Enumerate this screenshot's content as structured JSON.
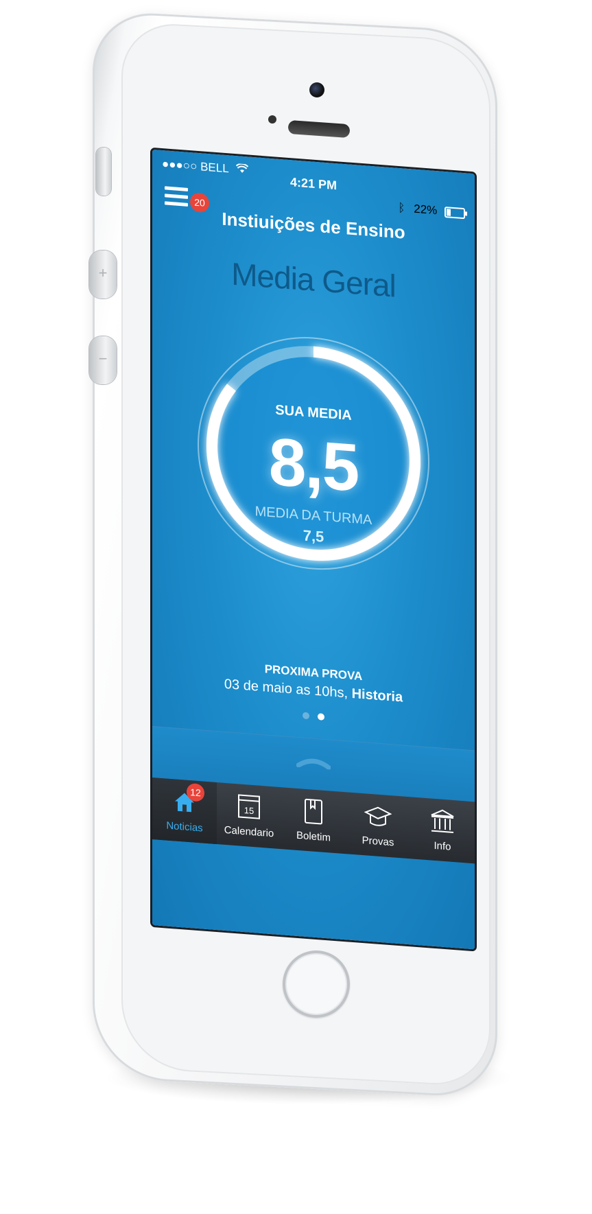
{
  "status_bar": {
    "carrier": "●●●○○ BELL",
    "time": "4:21 PM",
    "battery": "22%",
    "battery_level": 0.22
  },
  "nav": {
    "title": "Instiuições de Ensino",
    "menu_badge": "20"
  },
  "main": {
    "section_title": "Media Geral",
    "gauge": {
      "label": "SUA MEDIA",
      "value": "8,5",
      "progress": 0.85,
      "sub_label": "MEDIA DA TURMA",
      "sub_value": "7,5"
    },
    "next_exam": {
      "title": "PROXIMA PROVA",
      "date_text": "03 de maio as 10hs,",
      "subject": "Historia"
    },
    "pager": {
      "count": 2,
      "active": 1
    }
  },
  "tabs": [
    {
      "label": "Noticias",
      "icon": "home-icon",
      "badge": "12",
      "active": true
    },
    {
      "label": "Calendario",
      "icon": "calendar-icon",
      "day": "15",
      "active": false
    },
    {
      "label": "Boletim",
      "icon": "book-icon",
      "active": false
    },
    {
      "label": "Provas",
      "icon": "graduation-cap-icon",
      "active": false
    },
    {
      "label": "Info",
      "icon": "institution-icon",
      "active": false
    }
  ],
  "colors": {
    "screen_blue": "#1d8dcc",
    "title_dark_blue": "#0e5a8a",
    "badge_red": "#e8443a",
    "tab_active": "#38aef0"
  }
}
